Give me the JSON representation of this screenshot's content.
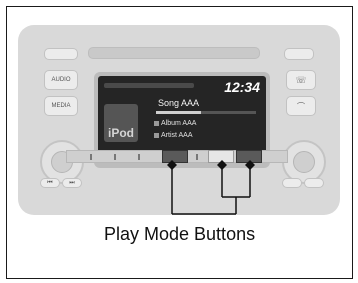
{
  "screen": {
    "clock": "12:34",
    "song": "Song AAA",
    "album": "Album AAA",
    "artist": "Artist AAA",
    "source_badge": "iPod",
    "progress": 0.45
  },
  "left_buttons": [
    "AUDIO",
    "MEDIA"
  ],
  "callout": {
    "label": "Play Mode Buttons"
  },
  "colors": {
    "panel": "#d9d9d9",
    "screen": "#252525",
    "ink": "#111111"
  }
}
